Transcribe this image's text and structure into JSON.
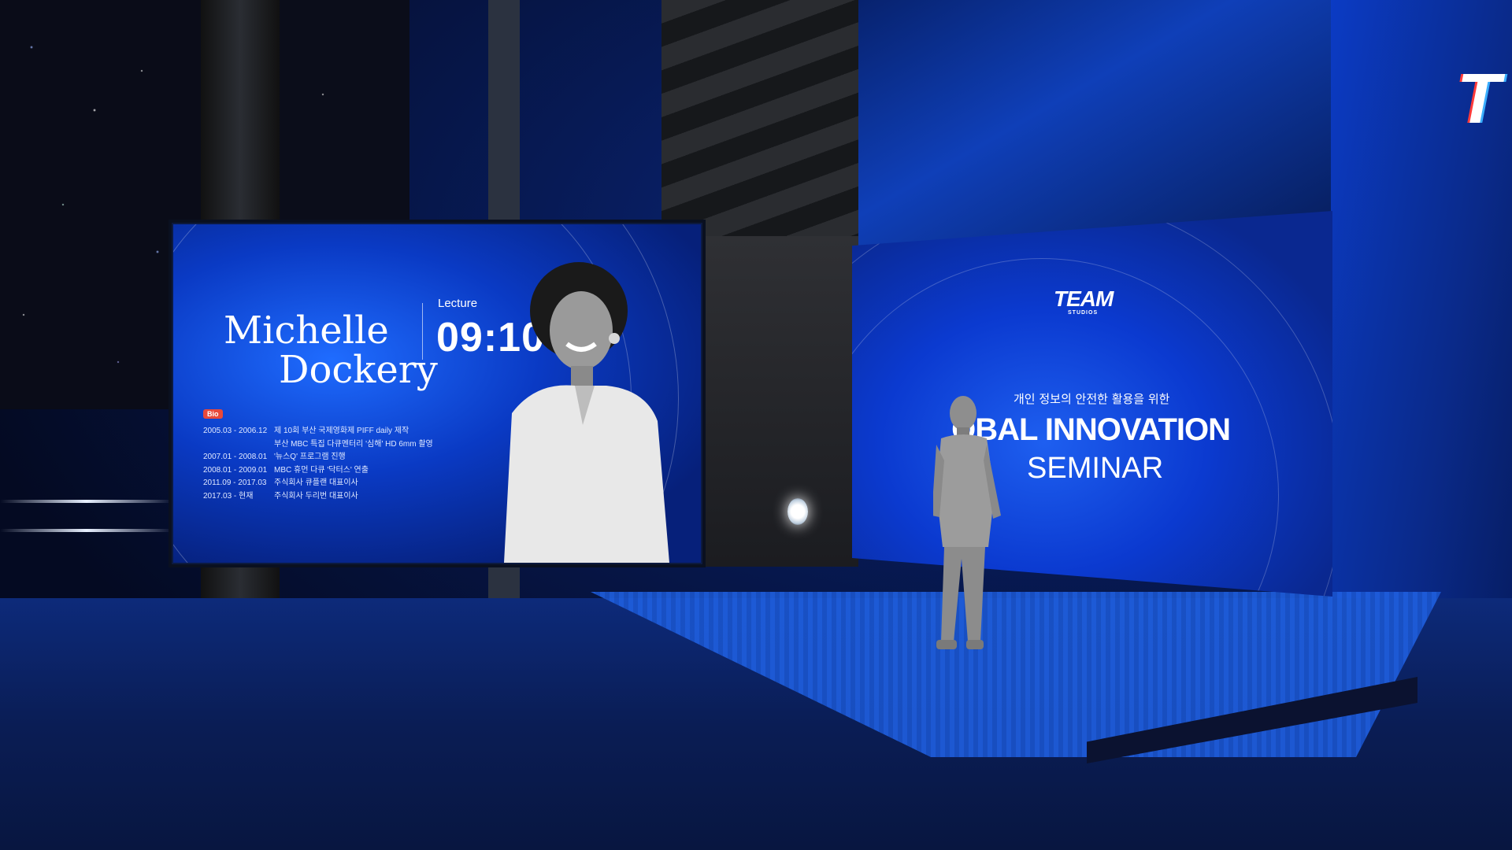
{
  "left_screen": {
    "speaker_name_line1": "Michelle",
    "speaker_name_line2": "Dockery",
    "lecture_label": "Lecture",
    "lecture_time": "09:10",
    "bio_label": "Bio",
    "bio_entries": [
      {
        "date": "2005.03 - 2006.12",
        "text": "제 10회 부산 국제영화제 PIFF daily 제작"
      },
      {
        "date": "",
        "text": "부산 MBC 특집 다큐멘터리 '심해' HD 6mm 촬영"
      },
      {
        "date": "2007.01 - 2008.01",
        "text": "'뉴스Q' 프로그램 진행"
      },
      {
        "date": "2008.01 - 2009.01",
        "text": "MBC 휴먼 다큐 '닥터스' 연출"
      },
      {
        "date": "2011.09 - 2017.03",
        "text": "주식회사 큐플랜 대표이사"
      },
      {
        "date": "2017.03 - 현재",
        "text": "주식회사 두리번 대표이사"
      }
    ]
  },
  "stage_screen": {
    "logo_main": "TEAM",
    "logo_sub": "STUDIOS",
    "subtitle": "개인 정보의 안전한 활용을 위한",
    "title": "OBAL INNOVATION",
    "title_line2": "SEMINAR"
  },
  "right_wall": {
    "logo_fragment": "T"
  },
  "colors": {
    "screen_blue": "#0a3ac4",
    "bio_badge": "#e8493a",
    "stage_floor": "#1f5fe0"
  }
}
